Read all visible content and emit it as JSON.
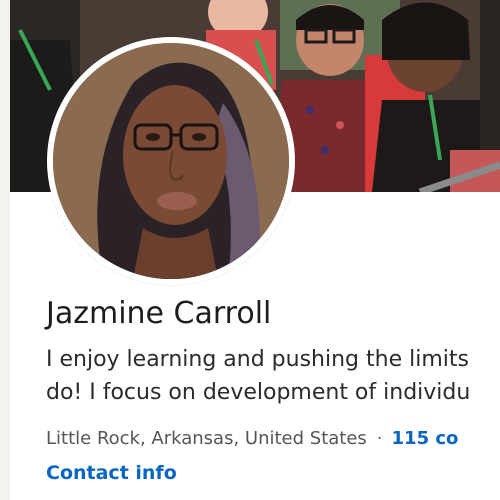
{
  "profile": {
    "name": "Jazmine Carroll",
    "headline_line1": "I enjoy learning and pushing the limits",
    "headline_line2": "do! I focus on development of individu",
    "location": "Little Rock, Arkansas, United States",
    "separator": "·",
    "connections": "115 co",
    "contact_info": "Contact info"
  },
  "colors": {
    "link": "#0a66c2",
    "card_background": "#ffffff",
    "page_background": "#f3f2ef"
  }
}
